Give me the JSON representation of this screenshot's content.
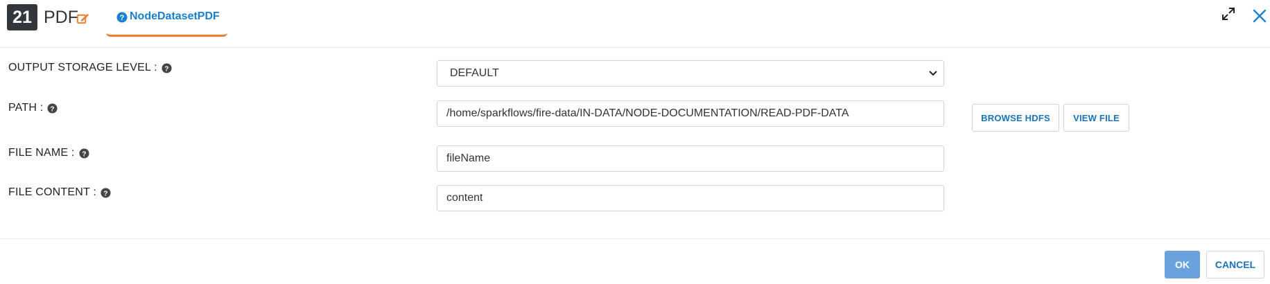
{
  "header": {
    "node_number": "21",
    "node_title": "PDF",
    "tab_label": "NodeDatasetPDF",
    "icons": {
      "edit": "edit-icon",
      "help": "question-circle-icon",
      "expand": "expand-icon",
      "close": "close-icon"
    }
  },
  "form": {
    "output_storage_level": {
      "label": "OUTPUT STORAGE LEVEL :",
      "value": "DEFAULT"
    },
    "path": {
      "label": "PATH :",
      "value": "/home/sparkflows/fire-data/IN-DATA/NODE-DOCUMENTATION/READ-PDF-DATA"
    },
    "file_name": {
      "label": "FILE NAME :",
      "value": "fileName"
    },
    "file_content": {
      "label": "FILE CONTENT :",
      "value": "content"
    }
  },
  "path_buttons": {
    "browse": "BROWSE HDFS",
    "view": "VIEW FILE"
  },
  "footer": {
    "ok": "OK",
    "cancel": "CANCEL"
  },
  "colors": {
    "accent_blue": "#1a7fd1",
    "accent_orange": "#f07b2c",
    "ok_button": "#69a2dd"
  }
}
